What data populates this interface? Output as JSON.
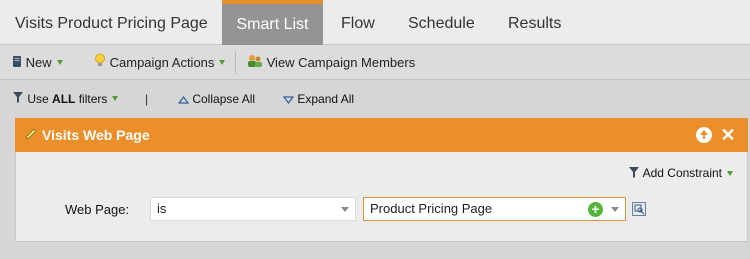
{
  "tabs": [
    {
      "label": "Visits Product Pricing Page"
    },
    {
      "label": "Smart List"
    },
    {
      "label": "Flow"
    },
    {
      "label": "Schedule"
    },
    {
      "label": "Results"
    }
  ],
  "toolbar": {
    "new_label": "New",
    "campaign_actions_label": "Campaign Actions",
    "view_members_label": "View Campaign Members"
  },
  "filterbar": {
    "use_prefix": "Use ",
    "use_bold": "ALL",
    "use_suffix": " filters",
    "separator": "|",
    "collapse_label": "Collapse All",
    "expand_label": "Expand All"
  },
  "filter": {
    "title": "Visits Web Page",
    "add_constraint_label": "Add Constraint",
    "field_label": "Web Page:",
    "operator_value": "is",
    "value_selected": "Product Pricing Page"
  },
  "colors": {
    "accent_orange": "#eb8f2b",
    "active_tab": "#949494",
    "add_green": "#56b33a"
  }
}
